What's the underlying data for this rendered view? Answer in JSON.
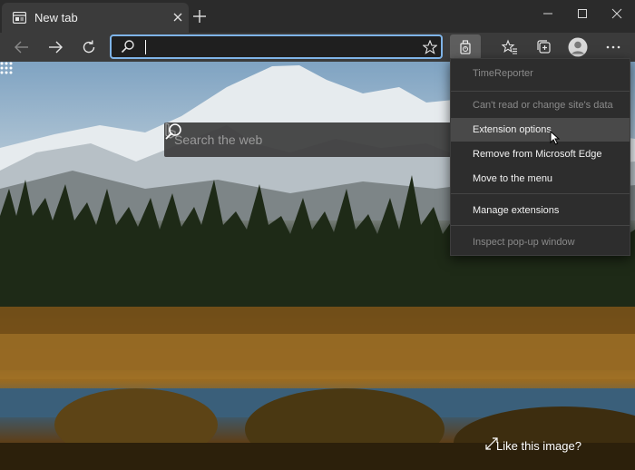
{
  "tab": {
    "title": "New tab"
  },
  "address_bar": {
    "value": "",
    "placeholder": ""
  },
  "search": {
    "placeholder": "Search the web"
  },
  "like_image": {
    "label": "Like this image?"
  },
  "extension_menu": {
    "extension_name": "TimeReporter",
    "items": [
      {
        "label": "Can't read or change site's data",
        "enabled": false
      },
      {
        "label": "Extension options",
        "enabled": true
      },
      {
        "label": "Remove from Microsoft Edge",
        "enabled": true
      },
      {
        "label": "Move to the menu",
        "enabled": true
      },
      {
        "label": "Manage extensions",
        "enabled": true
      },
      {
        "label": "Inspect pop-up window",
        "enabled": false
      }
    ]
  },
  "icons": {
    "tab_favicon": "new-tab-page-icon",
    "tab_close": "close-icon",
    "new_tab": "plus-icon",
    "minimize": "minimize-icon",
    "maximize": "maximize-icon",
    "close_window": "close-icon",
    "back": "arrow-left-icon",
    "forward": "arrow-right-icon",
    "refresh": "refresh-icon",
    "address_search": "search-icon",
    "favorite": "star-icon",
    "extension": "extension-icon",
    "favorites_list": "favorites-icon",
    "collections": "collections-icon",
    "profile": "profile-avatar-icon",
    "more": "ellipsis-icon",
    "apps": "apps-grid-icon",
    "bing": "bing-icon",
    "expand": "expand-icon"
  },
  "colors": {
    "accent_focus": "#7fb4e8",
    "tabstrip": "#2b2b2b",
    "toolbar": "#3b3b3b",
    "menu_bg": "#2d2d2d",
    "menu_hover": "#494949"
  }
}
